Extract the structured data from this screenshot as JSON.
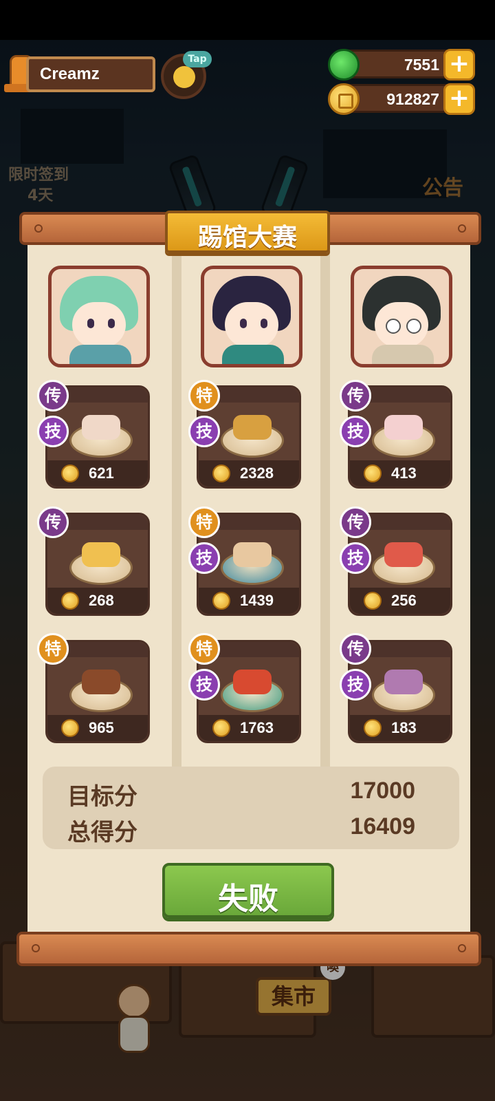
{
  "hud": {
    "player_name": "Creamz",
    "tap_label": "Tap",
    "gems": "7551",
    "coins": "912827",
    "plus_symbol": "+"
  },
  "background": {
    "signin_label": "限时签到",
    "signin_days": "4天",
    "notice_label": "公告",
    "market_sign": "集市",
    "market_bubble": "噢"
  },
  "modal": {
    "title": "踢馆大赛",
    "columns": [
      {
        "dishes": [
          {
            "tier": "传",
            "skill": "技",
            "score": "621"
          },
          {
            "tier": "传",
            "skill": "",
            "score": "268"
          },
          {
            "tier": "特",
            "skill": "",
            "score": "965"
          }
        ]
      },
      {
        "dishes": [
          {
            "tier": "特",
            "skill": "技",
            "score": "2328"
          },
          {
            "tier": "特",
            "skill": "技",
            "score": "1439"
          },
          {
            "tier": "特",
            "skill": "技",
            "score": "1763"
          }
        ]
      },
      {
        "dishes": [
          {
            "tier": "传",
            "skill": "技",
            "score": "413"
          },
          {
            "tier": "传",
            "skill": "技",
            "score": "256"
          },
          {
            "tier": "传",
            "skill": "技",
            "score": "183"
          }
        ]
      }
    ],
    "target_label": "目标分",
    "target_value": "17000",
    "total_label": "总得分",
    "total_value": "16409",
    "result_button": "失败"
  },
  "colors": {
    "panel_bg": "#efe3cb",
    "card_bg": "#5e3f32",
    "title_gold": "#f4bb36",
    "result_green": "#8cc84e"
  }
}
